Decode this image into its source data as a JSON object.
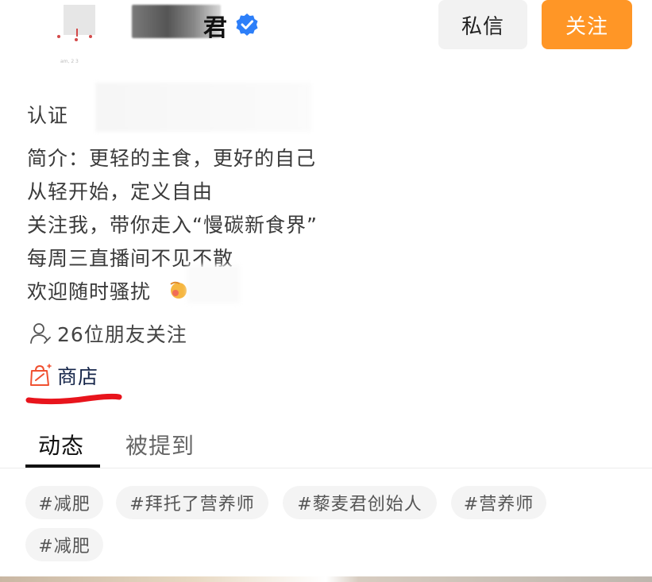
{
  "header": {
    "avatar_caption": "am, 2 3",
    "name_visible_suffix": "君",
    "message_button": "私信",
    "follow_button": "关注",
    "colors": {
      "follow": "#ff9626",
      "verified": "#2d7ff9"
    }
  },
  "bio": {
    "certification_label": "认证",
    "lines": [
      "简介：更轻的主食，更好的自己",
      "从轻开始，定义自由",
      "关注我，带你走入“慢碳新食界”",
      "每周三直播间不见不散",
      "欢迎随时骚扰"
    ]
  },
  "friends_following": "26位朋友关注",
  "shop_label": "商店",
  "tabs": [
    "动态",
    "被提到"
  ],
  "tags": [
    "#减肥",
    "#拜托了营养师",
    "#藜麦君创始人",
    "#营养师",
    "#减肥"
  ]
}
